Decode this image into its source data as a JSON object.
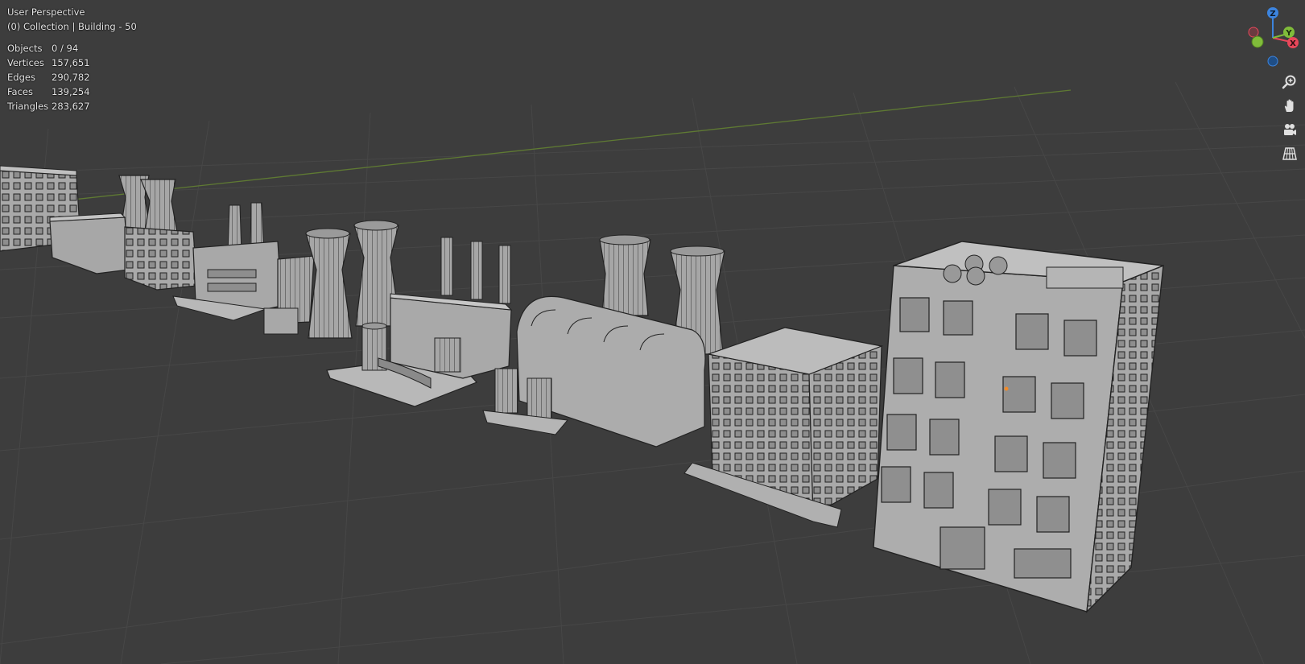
{
  "viewport": {
    "view_name": "User Perspective",
    "collection_info": "(0) Collection | Building - 50"
  },
  "stats": [
    {
      "label": "Objects",
      "value": "0 / 94"
    },
    {
      "label": "Vertices",
      "value": "157,651"
    },
    {
      "label": "Edges",
      "value": "290,782"
    },
    {
      "label": "Faces",
      "value": "139,254"
    },
    {
      "label": "Triangles",
      "value": "283,627"
    }
  ],
  "gizmo": {
    "x_label": "X",
    "y_label": "Y",
    "z_label": "Z",
    "x_color": "#e8475a",
    "y_color": "#80bc3a",
    "z_color": "#3c84de"
  },
  "nav_tools": [
    {
      "icon": "zoom-icon"
    },
    {
      "icon": "pan-hand-icon"
    },
    {
      "icon": "camera-icon"
    },
    {
      "icon": "ortho-grid-icon"
    }
  ],
  "colors": {
    "background": "#3d3d3d",
    "grid": "#474747",
    "y_axis": "#5f7a33",
    "model_fill": "#aaaaaa",
    "model_edge": "#222222"
  }
}
